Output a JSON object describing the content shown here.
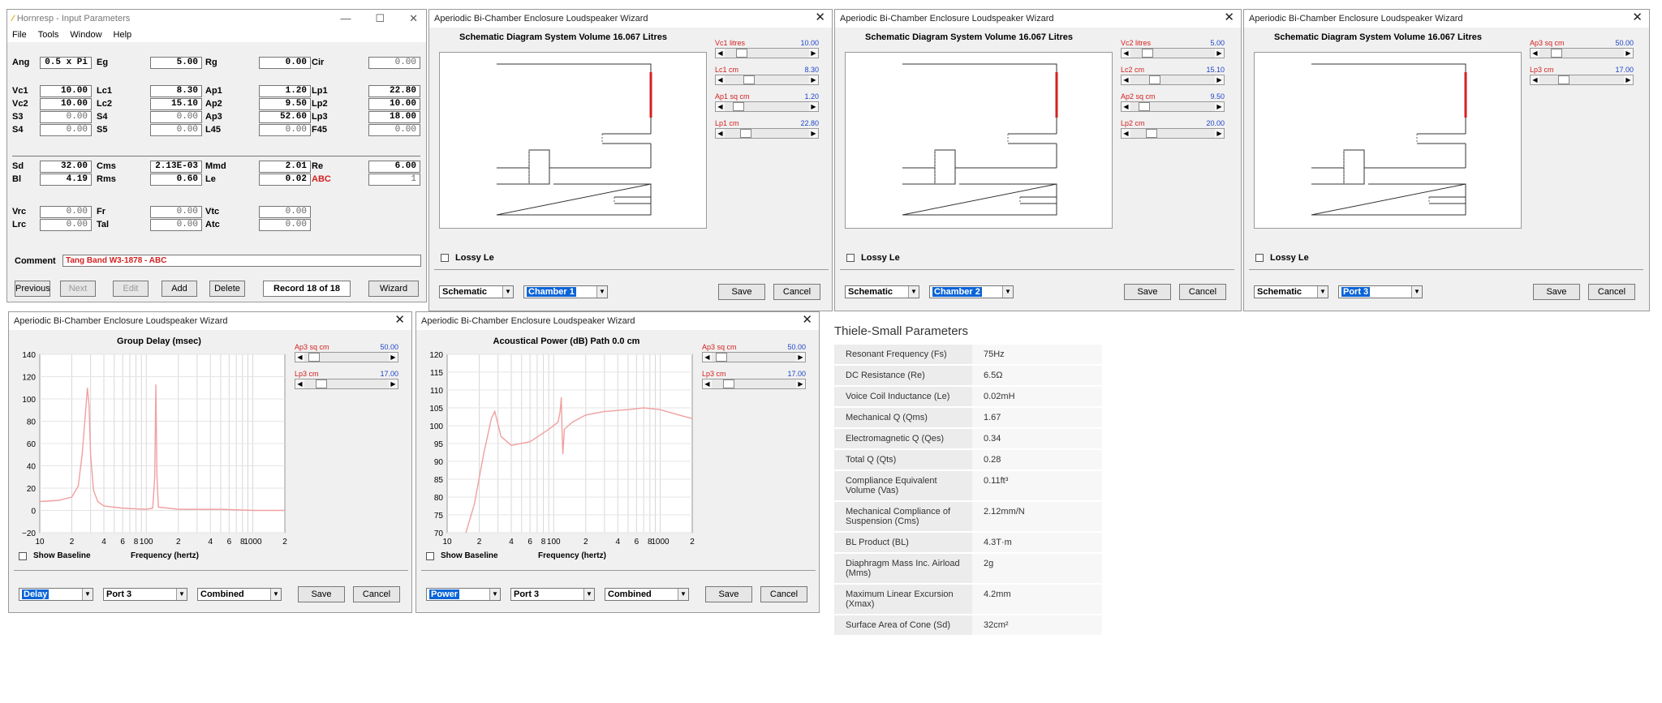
{
  "input_win": {
    "title": "Hornresp - Input Parameters",
    "menu": [
      "File",
      "Tools",
      "Window",
      "Help"
    ],
    "params": [
      {
        "l": "Ang",
        "v": "0.5 x Pi"
      },
      {
        "l": "Eg",
        "v": "5.00"
      },
      {
        "l": "Rg",
        "v": "0.00"
      },
      {
        "l": "Cir",
        "v": "0.00"
      },
      {
        "l": "Vc1",
        "v": "10.00"
      },
      {
        "l": "Lc1",
        "v": "8.30"
      },
      {
        "l": "Ap1",
        "v": "1.20"
      },
      {
        "l": "Lp1",
        "v": "22.80"
      },
      {
        "l": "Vc2",
        "v": "10.00"
      },
      {
        "l": "Lc2",
        "v": "15.10"
      },
      {
        "l": "Ap2",
        "v": "9.50"
      },
      {
        "l": "Lp2",
        "v": "10.00"
      },
      {
        "l": "S3",
        "v": "0.00"
      },
      {
        "l": "S4",
        "v": "0.00"
      },
      {
        "l": "Ap3",
        "v": "52.60"
      },
      {
        "l": "Lp3",
        "v": "18.00"
      },
      {
        "l": "S4",
        "v": "0.00"
      },
      {
        "l": "S5",
        "v": "0.00"
      },
      {
        "l": "L45",
        "v": "0.00"
      },
      {
        "l": "F45",
        "v": "0.00"
      },
      {
        "l": "Sd",
        "v": "32.00"
      },
      {
        "l": "Cms",
        "v": "2.13E-03"
      },
      {
        "l": "Mmd",
        "v": "2.01"
      },
      {
        "l": "Re",
        "v": "6.00"
      },
      {
        "l": "Bl",
        "v": "4.19"
      },
      {
        "l": "Rms",
        "v": "0.60"
      },
      {
        "l": "Le",
        "v": "0.02"
      },
      {
        "l": "ABC",
        "v": "1"
      },
      {
        "l": "Vrc",
        "v": "0.00"
      },
      {
        "l": "Fr",
        "v": "0.00"
      },
      {
        "l": "Vtc",
        "v": "0.00"
      },
      {
        "l": "Lrc",
        "v": "0.00"
      },
      {
        "l": "Tal",
        "v": "0.00"
      },
      {
        "l": "Atc",
        "v": "0.00"
      }
    ],
    "comment_label": "Comment",
    "comment": "Tang Band W3-1878 - ABC",
    "buttons": {
      "previous": "Previous",
      "next": "Next",
      "edit": "Edit",
      "add": "Add",
      "delete": "Delete",
      "record": "Record 18 of 18",
      "wizard": "Wizard"
    }
  },
  "wizard_title": "Aperiodic Bi-Chamber Enclosure Loudspeaker Wizard",
  "schem_title": "Schematic Diagram   System Volume 16.067 Litres",
  "lossy_label": "Lossy Le",
  "save": "Save",
  "cancel": "Cancel",
  "schematic_sel": "Schematic",
  "w1": {
    "select": "Chamber 1",
    "sliders": [
      {
        "l": "Vc1  litres",
        "v": "10.00"
      },
      {
        "l": "Lc1  cm",
        "v": "8.30"
      },
      {
        "l": "Ap1  sq cm",
        "v": "1.20"
      },
      {
        "l": "Lp1  cm",
        "v": "22.80"
      }
    ]
  },
  "w2": {
    "select": "Chamber 2",
    "sliders": [
      {
        "l": "Vc2  litres",
        "v": "5.00"
      },
      {
        "l": "Lc2  cm",
        "v": "15.10"
      },
      {
        "l": "Ap2  sq cm",
        "v": "9.50"
      },
      {
        "l": "Lp2  cm",
        "v": "20.00"
      }
    ]
  },
  "w3": {
    "select": "Port 3",
    "sliders": [
      {
        "l": "Ap3  sq cm",
        "v": "50.00"
      },
      {
        "l": "Lp3  cm",
        "v": "17.00"
      }
    ]
  },
  "delay_win": {
    "chart_title": "Group Delay (msec)",
    "sliders": [
      {
        "l": "Ap3  sq cm",
        "v": "50.00"
      },
      {
        "l": "Lp3  cm",
        "v": "17.00"
      }
    ],
    "show_baseline": "Show Baseline",
    "freq_label": "Frequency (hertz)",
    "selects": [
      "Delay",
      "Port 3",
      "Combined"
    ],
    "yticks": [
      "140",
      "120",
      "100",
      "80",
      "60",
      "40",
      "20",
      "0",
      "−20"
    ],
    "xticks": [
      "10",
      "2",
      "4",
      "6",
      "8",
      "100",
      "2",
      "4",
      "6",
      "8",
      "1000",
      "2"
    ]
  },
  "power_win": {
    "chart_title": "Acoustical Power (dB)   Path 0.0 cm",
    "sliders": [
      {
        "l": "Ap3  sq cm",
        "v": "50.00"
      },
      {
        "l": "Lp3  cm",
        "v": "17.00"
      }
    ],
    "show_baseline": "Show Baseline",
    "freq_label": "Frequency (hertz)",
    "selects": [
      "Power",
      "Port 3",
      "Combined"
    ],
    "yticks": [
      "120",
      "115",
      "110",
      "105",
      "100",
      "95",
      "90",
      "85",
      "80",
      "75",
      "70"
    ],
    "xticks": [
      "10",
      "2",
      "4",
      "6",
      "8",
      "100",
      "2",
      "4",
      "6",
      "8",
      "1000",
      "2"
    ]
  },
  "ts": {
    "title": "Thiele-Small Parameters",
    "rows": [
      {
        "k": "Resonant Frequency (Fs)",
        "v": "75Hz"
      },
      {
        "k": "DC Resistance (Re)",
        "v": "6.5Ω"
      },
      {
        "k": "Voice Coil Inductance (Le)",
        "v": "0.02mH"
      },
      {
        "k": "Mechanical Q (Qms)",
        "v": "1.67"
      },
      {
        "k": "Electromagnetic Q (Qes)",
        "v": "0.34"
      },
      {
        "k": "Total Q (Qts)",
        "v": "0.28"
      },
      {
        "k": "Compliance Equivalent Volume (Vas)",
        "v": "0.11ft³"
      },
      {
        "k": "Mechanical Compliance of Suspension (Cms)",
        "v": "2.12mm/N"
      },
      {
        "k": "BL Product (BL)",
        "v": "4.3T·m"
      },
      {
        "k": "Diaphragm Mass Inc. Airload (Mms)",
        "v": "2g"
      },
      {
        "k": "Maximum Linear Excursion (Xmax)",
        "v": "4.2mm"
      },
      {
        "k": "Surface Area of Cone (Sd)",
        "v": "32cm²"
      }
    ]
  },
  "chart_data": [
    {
      "type": "line",
      "title": "Group Delay (msec)",
      "xlabel": "Frequency (hertz)",
      "ylabel": "",
      "xscale": "log",
      "xlim": [
        10,
        2000
      ],
      "ylim": [
        -20,
        140
      ],
      "series": [
        {
          "values": [
            [
              10,
              8
            ],
            [
              15,
              9
            ],
            [
              20,
              12
            ],
            [
              23,
              22
            ],
            [
              25,
              50
            ],
            [
              27,
              90
            ],
            [
              28,
              110
            ],
            [
              29,
              95
            ],
            [
              30,
              50
            ],
            [
              32,
              18
            ],
            [
              35,
              8
            ],
            [
              40,
              4
            ],
            [
              60,
              2
            ],
            [
              100,
              1
            ],
            [
              115,
              2
            ],
            [
              120,
              30
            ],
            [
              123,
              113
            ],
            [
              126,
              30
            ],
            [
              130,
              3
            ],
            [
              200,
              1
            ],
            [
              500,
              1
            ],
            [
              1000,
              0
            ],
            [
              2000,
              0
            ]
          ]
        }
      ]
    },
    {
      "type": "line",
      "title": "Acoustical Power (dB)   Path 0.0 cm",
      "xlabel": "Frequency (hertz)",
      "ylabel": "",
      "xscale": "log",
      "xlim": [
        10,
        2000
      ],
      "ylim": [
        70,
        120
      ],
      "series": [
        {
          "values": [
            [
              15,
              70
            ],
            [
              18,
              78
            ],
            [
              22,
              92
            ],
            [
              26,
              102
            ],
            [
              28,
              104
            ],
            [
              32,
              97
            ],
            [
              40,
              94.5
            ],
            [
              60,
              95.5
            ],
            [
              90,
              99
            ],
            [
              110,
              101
            ],
            [
              115,
              104
            ],
            [
              118,
              108
            ],
            [
              120,
              98
            ],
            [
              122,
              92
            ],
            [
              126,
              99
            ],
            [
              150,
              101
            ],
            [
              200,
              103
            ],
            [
              300,
              104
            ],
            [
              500,
              104.5
            ],
            [
              700,
              105
            ],
            [
              1000,
              104.5
            ],
            [
              1500,
              103
            ],
            [
              2000,
              102
            ]
          ]
        }
      ]
    }
  ]
}
